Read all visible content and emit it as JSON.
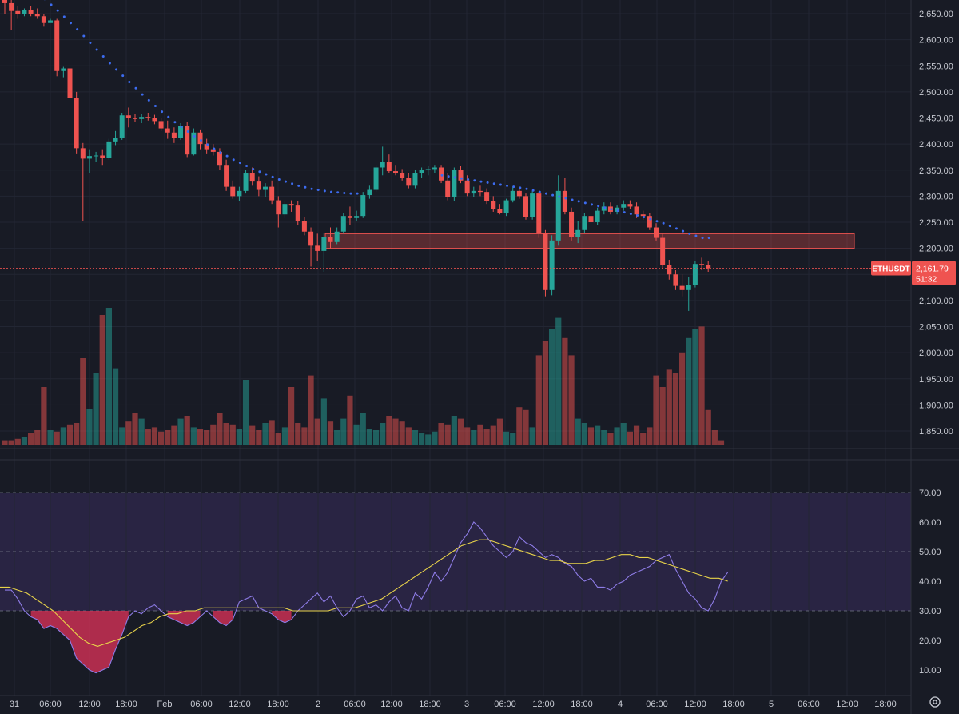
{
  "chart_data": [
    {
      "type": "candlestick",
      "symbol": "ETHUSDT",
      "last_price": "2,161.79",
      "countdown": "51:32",
      "ylim": [
        1825,
        2680
      ],
      "y_ticks": [
        "2,650.00",
        "2,600.00",
        "2,550.00",
        "2,500.00",
        "2,450.00",
        "2,400.00",
        "2,350.00",
        "2,300.00",
        "2,250.00",
        "2,200.00",
        "2,150.00",
        "2,100.00",
        "2,050.00",
        "2,000.00",
        "1,950.00",
        "1,900.00",
        "1,850.00"
      ],
      "x_ticks": [
        "31",
        "06:00",
        "12:00",
        "18:00",
        "Feb",
        "06:00",
        "12:00",
        "18:00",
        "2",
        "06:00",
        "12:00",
        "18:00",
        "3",
        "06:00",
        "12:00",
        "18:00",
        "4",
        "06:00",
        "12:00",
        "18:00",
        "5",
        "06:00",
        "12:00",
        "18:00"
      ],
      "candles": [
        {
          "o": 2702,
          "h": 2712,
          "l": 2650,
          "c": 2670
        },
        {
          "o": 2670,
          "h": 2685,
          "l": 2618,
          "c": 2655
        },
        {
          "o": 2655,
          "h": 2665,
          "l": 2640,
          "c": 2650
        },
        {
          "o": 2650,
          "h": 2660,
          "l": 2645,
          "c": 2657
        },
        {
          "o": 2657,
          "h": 2665,
          "l": 2645,
          "c": 2650
        },
        {
          "o": 2650,
          "h": 2660,
          "l": 2640,
          "c": 2645
        },
        {
          "o": 2645,
          "h": 2650,
          "l": 2625,
          "c": 2632
        },
        {
          "o": 2632,
          "h": 2640,
          "l": 2635,
          "c": 2637
        },
        {
          "o": 2637,
          "h": 2640,
          "l": 2530,
          "c": 2540
        },
        {
          "o": 2540,
          "h": 2548,
          "l": 2528,
          "c": 2545
        },
        {
          "o": 2545,
          "h": 2560,
          "l": 2478,
          "c": 2488
        },
        {
          "o": 2488,
          "h": 2500,
          "l": 2382,
          "c": 2392
        },
        {
          "o": 2392,
          "h": 2402,
          "l": 2252,
          "c": 2372
        },
        {
          "o": 2372,
          "h": 2390,
          "l": 2345,
          "c": 2377
        },
        {
          "o": 2377,
          "h": 2385,
          "l": 2365,
          "c": 2378
        },
        {
          "o": 2378,
          "h": 2390,
          "l": 2360,
          "c": 2373
        },
        {
          "o": 2373,
          "h": 2410,
          "l": 2370,
          "c": 2405
        },
        {
          "o": 2405,
          "h": 2425,
          "l": 2398,
          "c": 2412
        },
        {
          "o": 2412,
          "h": 2460,
          "l": 2408,
          "c": 2455
        },
        {
          "o": 2455,
          "h": 2470,
          "l": 2432,
          "c": 2450
        },
        {
          "o": 2450,
          "h": 2458,
          "l": 2442,
          "c": 2448
        },
        {
          "o": 2448,
          "h": 2458,
          "l": 2440,
          "c": 2452
        },
        {
          "o": 2452,
          "h": 2460,
          "l": 2445,
          "c": 2450
        },
        {
          "o": 2450,
          "h": 2456,
          "l": 2438,
          "c": 2444
        },
        {
          "o": 2444,
          "h": 2450,
          "l": 2425,
          "c": 2430
        },
        {
          "o": 2430,
          "h": 2445,
          "l": 2410,
          "c": 2422
        },
        {
          "o": 2422,
          "h": 2432,
          "l": 2402,
          "c": 2412
        },
        {
          "o": 2412,
          "h": 2440,
          "l": 2408,
          "c": 2435
        },
        {
          "o": 2435,
          "h": 2442,
          "l": 2375,
          "c": 2380
        },
        {
          "o": 2380,
          "h": 2430,
          "l": 2378,
          "c": 2422
        },
        {
          "o": 2422,
          "h": 2428,
          "l": 2390,
          "c": 2400
        },
        {
          "o": 2400,
          "h": 2410,
          "l": 2382,
          "c": 2390
        },
        {
          "o": 2390,
          "h": 2400,
          "l": 2378,
          "c": 2385
        },
        {
          "o": 2385,
          "h": 2392,
          "l": 2350,
          "c": 2360
        },
        {
          "o": 2360,
          "h": 2370,
          "l": 2310,
          "c": 2318
        },
        {
          "o": 2318,
          "h": 2330,
          "l": 2295,
          "c": 2300
        },
        {
          "o": 2300,
          "h": 2318,
          "l": 2290,
          "c": 2310
        },
        {
          "o": 2310,
          "h": 2350,
          "l": 2305,
          "c": 2345
        },
        {
          "o": 2345,
          "h": 2355,
          "l": 2320,
          "c": 2328
        },
        {
          "o": 2328,
          "h": 2338,
          "l": 2300,
          "c": 2312
        },
        {
          "o": 2312,
          "h": 2325,
          "l": 2298,
          "c": 2318
        },
        {
          "o": 2318,
          "h": 2330,
          "l": 2285,
          "c": 2292
        },
        {
          "o": 2292,
          "h": 2300,
          "l": 2240,
          "c": 2265
        },
        {
          "o": 2265,
          "h": 2290,
          "l": 2258,
          "c": 2285
        },
        {
          "o": 2285,
          "h": 2292,
          "l": 2270,
          "c": 2282
        },
        {
          "o": 2282,
          "h": 2290,
          "l": 2245,
          "c": 2252
        },
        {
          "o": 2252,
          "h": 2260,
          "l": 2225,
          "c": 2232
        },
        {
          "o": 2232,
          "h": 2240,
          "l": 2165,
          "c": 2205
        },
        {
          "o": 2205,
          "h": 2228,
          "l": 2175,
          "c": 2195
        },
        {
          "o": 2195,
          "h": 2230,
          "l": 2155,
          "c": 2222
        },
        {
          "o": 2222,
          "h": 2240,
          "l": 2200,
          "c": 2212
        },
        {
          "o": 2212,
          "h": 2240,
          "l": 2208,
          "c": 2232
        },
        {
          "o": 2232,
          "h": 2268,
          "l": 2228,
          "c": 2262
        },
        {
          "o": 2262,
          "h": 2280,
          "l": 2245,
          "c": 2258
        },
        {
          "o": 2258,
          "h": 2272,
          "l": 2252,
          "c": 2262
        },
        {
          "o": 2262,
          "h": 2308,
          "l": 2258,
          "c": 2302
        },
        {
          "o": 2302,
          "h": 2320,
          "l": 2295,
          "c": 2312
        },
        {
          "o": 2312,
          "h": 2360,
          "l": 2308,
          "c": 2355
        },
        {
          "o": 2355,
          "h": 2395,
          "l": 2340,
          "c": 2365
        },
        {
          "o": 2365,
          "h": 2380,
          "l": 2345,
          "c": 2348
        },
        {
          "o": 2348,
          "h": 2360,
          "l": 2340,
          "c": 2345
        },
        {
          "o": 2345,
          "h": 2352,
          "l": 2330,
          "c": 2335
        },
        {
          "o": 2335,
          "h": 2345,
          "l": 2315,
          "c": 2320
        },
        {
          "o": 2320,
          "h": 2350,
          "l": 2315,
          "c": 2345
        },
        {
          "o": 2345,
          "h": 2355,
          "l": 2335,
          "c": 2350
        },
        {
          "o": 2350,
          "h": 2358,
          "l": 2340,
          "c": 2352
        },
        {
          "o": 2352,
          "h": 2360,
          "l": 2345,
          "c": 2355
        },
        {
          "o": 2355,
          "h": 2360,
          "l": 2325,
          "c": 2330
        },
        {
          "o": 2330,
          "h": 2345,
          "l": 2292,
          "c": 2298
        },
        {
          "o": 2298,
          "h": 2355,
          "l": 2290,
          "c": 2350
        },
        {
          "o": 2350,
          "h": 2358,
          "l": 2325,
          "c": 2330
        },
        {
          "o": 2330,
          "h": 2340,
          "l": 2300,
          "c": 2305
        },
        {
          "o": 2305,
          "h": 2318,
          "l": 2298,
          "c": 2310
        },
        {
          "o": 2310,
          "h": 2320,
          "l": 2300,
          "c": 2308
        },
        {
          "o": 2308,
          "h": 2315,
          "l": 2285,
          "c": 2290
        },
        {
          "o": 2290,
          "h": 2300,
          "l": 2270,
          "c": 2275
        },
        {
          "o": 2275,
          "h": 2285,
          "l": 2265,
          "c": 2268
        },
        {
          "o": 2268,
          "h": 2295,
          "l": 2262,
          "c": 2292
        },
        {
          "o": 2292,
          "h": 2318,
          "l": 2288,
          "c": 2310
        },
        {
          "o": 2310,
          "h": 2318,
          "l": 2295,
          "c": 2300
        },
        {
          "o": 2300,
          "h": 2305,
          "l": 2255,
          "c": 2260
        },
        {
          "o": 2260,
          "h": 2310,
          "l": 2255,
          "c": 2305
        },
        {
          "o": 2305,
          "h": 2308,
          "l": 2220,
          "c": 2228
        },
        {
          "o": 2228,
          "h": 2235,
          "l": 2108,
          "c": 2120
        },
        {
          "o": 2120,
          "h": 2225,
          "l": 2110,
          "c": 2215
        },
        {
          "o": 2215,
          "h": 2340,
          "l": 2205,
          "c": 2310
        },
        {
          "o": 2310,
          "h": 2335,
          "l": 2265,
          "c": 2270
        },
        {
          "o": 2270,
          "h": 2278,
          "l": 2215,
          "c": 2222
        },
        {
          "o": 2222,
          "h": 2252,
          "l": 2210,
          "c": 2235
        },
        {
          "o": 2235,
          "h": 2268,
          "l": 2230,
          "c": 2262
        },
        {
          "o": 2262,
          "h": 2275,
          "l": 2245,
          "c": 2250
        },
        {
          "o": 2250,
          "h": 2278,
          "l": 2245,
          "c": 2272
        },
        {
          "o": 2272,
          "h": 2288,
          "l": 2265,
          "c": 2280
        },
        {
          "o": 2280,
          "h": 2288,
          "l": 2265,
          "c": 2270
        },
        {
          "o": 2270,
          "h": 2282,
          "l": 2265,
          "c": 2278
        },
        {
          "o": 2278,
          "h": 2292,
          "l": 2272,
          "c": 2285
        },
        {
          "o": 2285,
          "h": 2292,
          "l": 2275,
          "c": 2280
        },
        {
          "o": 2280,
          "h": 2288,
          "l": 2258,
          "c": 2265
        },
        {
          "o": 2265,
          "h": 2272,
          "l": 2255,
          "c": 2262
        },
        {
          "o": 2262,
          "h": 2268,
          "l": 2235,
          "c": 2240
        },
        {
          "o": 2240,
          "h": 2248,
          "l": 2215,
          "c": 2220
        },
        {
          "o": 2220,
          "h": 2230,
          "l": 2160,
          "c": 2168
        },
        {
          "o": 2168,
          "h": 2178,
          "l": 2140,
          "c": 2150
        },
        {
          "o": 2150,
          "h": 2158,
          "l": 2120,
          "c": 2128
        },
        {
          "o": 2128,
          "h": 2150,
          "l": 2108,
          "c": 2120
        },
        {
          "o": 2120,
          "h": 2145,
          "l": 2080,
          "c": 2130
        },
        {
          "o": 2130,
          "h": 2175,
          "l": 2125,
          "c": 2170
        },
        {
          "o": 2170,
          "h": 2182,
          "l": 2158,
          "c": 2168
        },
        {
          "o": 2168,
          "h": 2175,
          "l": 2155,
          "c": 2161.79
        }
      ],
      "sar": [
        2725,
        2718,
        2712,
        2705,
        2697,
        2688,
        2678,
        2667,
        2656,
        2644,
        2632,
        2620,
        2607,
        2594,
        2581,
        2568,
        2555,
        2543,
        2531,
        2519,
        2507,
        2495,
        2484,
        2473,
        2462,
        2452,
        2442,
        2433,
        2424,
        2415,
        2407,
        2399,
        2391,
        2384,
        2377,
        2370,
        2364,
        2358,
        2352,
        2347,
        2342,
        2337,
        2332,
        2328,
        2324,
        2320,
        2317,
        2314,
        2312,
        2310,
        2308,
        2307,
        2306,
        2305,
        2305,
        null,
        null,
        null,
        null,
        null,
        null,
        null,
        null,
        null,
        null,
        null,
        null,
        2340,
        2338,
        2336,
        2334,
        2332,
        2330,
        2328,
        2326,
        2324,
        2322,
        2320,
        2318,
        2316,
        2314,
        2311,
        2308,
        2305,
        2302,
        2299,
        2296,
        2293,
        2290,
        2287,
        2284,
        2281,
        2278,
        2275,
        2272,
        2269,
        2266,
        2263,
        2260,
        2256,
        2252,
        2248,
        2243,
        2238,
        2233,
        2228,
        2224,
        2220,
        2220
      ],
      "zone": {
        "from": 2200,
        "to": 2228
      },
      "volume_max": 100,
      "volume": [
        3,
        3,
        4,
        5,
        8,
        10,
        40,
        10,
        9,
        12,
        14,
        15,
        60,
        25,
        50,
        90,
        95,
        53,
        12,
        16,
        22,
        18,
        11,
        12,
        9,
        10,
        13,
        18,
        20,
        12,
        11,
        10,
        14,
        22,
        15,
        14,
        11,
        45,
        13,
        10,
        15,
        17,
        8,
        12,
        40,
        15,
        12,
        48,
        18,
        32,
        16,
        10,
        18,
        34,
        14,
        22,
        11,
        10,
        15,
        20,
        18,
        16,
        12,
        10,
        8,
        7,
        9,
        15,
        14,
        20,
        18,
        12,
        10,
        14,
        11,
        13,
        18,
        9,
        8,
        26,
        24,
        12,
        62,
        72,
        80,
        88,
        74,
        62,
        18,
        15,
        12,
        13,
        10,
        8,
        12,
        15,
        9,
        13,
        8,
        12,
        48,
        40,
        52,
        50,
        64,
        74,
        80,
        82,
        24,
        10,
        3
      ],
      "rsi_ticks": [
        "70.00",
        "60.00",
        "50.00",
        "40.00",
        "30.00",
        "20.00",
        "10.00"
      ],
      "rsi_ylim": [
        2,
        82
      ],
      "rsi_bands": {
        "upper": 70,
        "middle": 50,
        "lower": 30
      },
      "rsi": [
        37,
        37,
        34,
        30,
        28,
        27,
        24,
        25,
        24,
        22,
        20,
        14,
        12,
        10,
        9,
        10,
        11,
        17,
        22,
        28,
        30,
        29,
        31,
        32,
        30,
        28,
        27,
        26,
        25,
        26,
        28,
        30,
        28,
        26,
        25,
        27,
        33,
        34,
        35,
        31,
        30,
        29,
        27,
        26,
        27,
        30,
        32,
        34,
        36,
        33,
        35,
        31,
        28,
        30,
        34,
        35,
        31,
        32,
        30,
        33,
        35,
        31,
        30,
        36,
        34,
        38,
        43,
        40,
        43,
        48,
        53,
        56,
        60,
        58,
        55,
        52,
        50,
        48,
        50,
        55,
        53,
        52,
        50,
        48,
        49,
        48,
        46,
        45,
        42,
        40,
        41,
        38,
        38,
        37,
        39,
        40,
        42,
        43,
        44,
        45,
        47,
        48,
        49,
        44,
        40,
        36,
        34,
        31,
        30,
        34,
        40,
        43
      ],
      "rsi_ma": [
        38,
        38,
        37,
        36,
        34,
        32,
        30,
        27,
        24,
        21,
        19,
        18,
        19,
        20,
        21,
        23,
        25,
        26,
        28,
        29,
        29,
        30,
        30,
        31,
        31,
        31,
        31,
        31,
        31,
        31,
        31,
        31,
        31,
        30,
        30,
        30,
        30,
        30,
        31,
        31,
        31,
        32,
        33,
        34,
        36,
        38,
        40,
        42,
        44,
        46,
        48,
        50,
        52,
        53,
        54,
        54,
        53,
        52,
        51,
        50,
        49,
        48,
        47,
        47,
        46,
        46,
        46,
        47,
        47,
        48,
        49,
        49,
        48,
        48,
        47,
        46,
        45,
        44,
        43,
        42,
        41,
        41,
        40
      ],
      "rsi_ma_start": 0
    }
  ]
}
